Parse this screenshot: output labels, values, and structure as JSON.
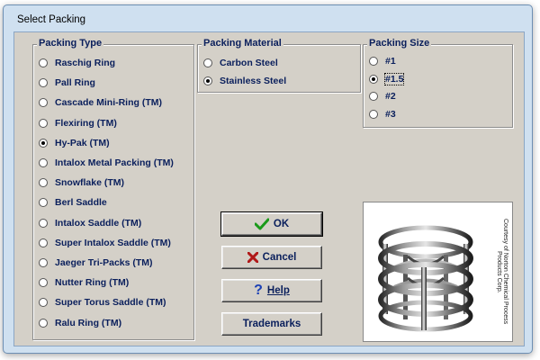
{
  "window": {
    "title": "Select Packing"
  },
  "packing_type": {
    "legend": "Packing Type",
    "options": [
      {
        "label": "Raschig Ring",
        "selected": false
      },
      {
        "label": "Pall Ring",
        "selected": false
      },
      {
        "label": "Cascade Mini-Ring (TM)",
        "selected": false
      },
      {
        "label": "Flexiring (TM)",
        "selected": false
      },
      {
        "label": "Hy-Pak (TM)",
        "selected": true
      },
      {
        "label": "Intalox Metal Packing (TM)",
        "selected": false
      },
      {
        "label": "Snowflake (TM)",
        "selected": false
      },
      {
        "label": "Berl Saddle",
        "selected": false
      },
      {
        "label": "Intalox Saddle (TM)",
        "selected": false
      },
      {
        "label": "Super Intalox Saddle (TM)",
        "selected": false
      },
      {
        "label": "Jaeger Tri-Packs (TM)",
        "selected": false
      },
      {
        "label": "Nutter Ring (TM)",
        "selected": false
      },
      {
        "label": "Super Torus Saddle (TM)",
        "selected": false
      },
      {
        "label": "Ralu Ring (TM)",
        "selected": false
      }
    ]
  },
  "packing_material": {
    "legend": "Packing Material",
    "options": [
      {
        "label": "Carbon Steel",
        "selected": false
      },
      {
        "label": "Stainless Steel",
        "selected": true
      }
    ]
  },
  "packing_size": {
    "legend": "Packing Size",
    "options": [
      {
        "label": "#1",
        "selected": false
      },
      {
        "label": "#1.5",
        "selected": true
      },
      {
        "label": "#2",
        "selected": false
      },
      {
        "label": "#3",
        "selected": false
      }
    ]
  },
  "buttons": {
    "ok": "OK",
    "cancel": "Cancel",
    "help": "Help",
    "trademarks": "Trademarks"
  },
  "image_credit": "Courtesy of Norton Chemical Process Products Corp.",
  "colors": {
    "label_text": "#0a1f5c",
    "dialog_face": "#d4d0c8",
    "frame": "#cfe0f0",
    "ok_check": "#1a9a1a",
    "cancel_x": "#b01818",
    "help_q": "#1a3fb5"
  },
  "icons": {
    "ok": "check-icon",
    "cancel": "x-icon",
    "help": "question-icon"
  }
}
